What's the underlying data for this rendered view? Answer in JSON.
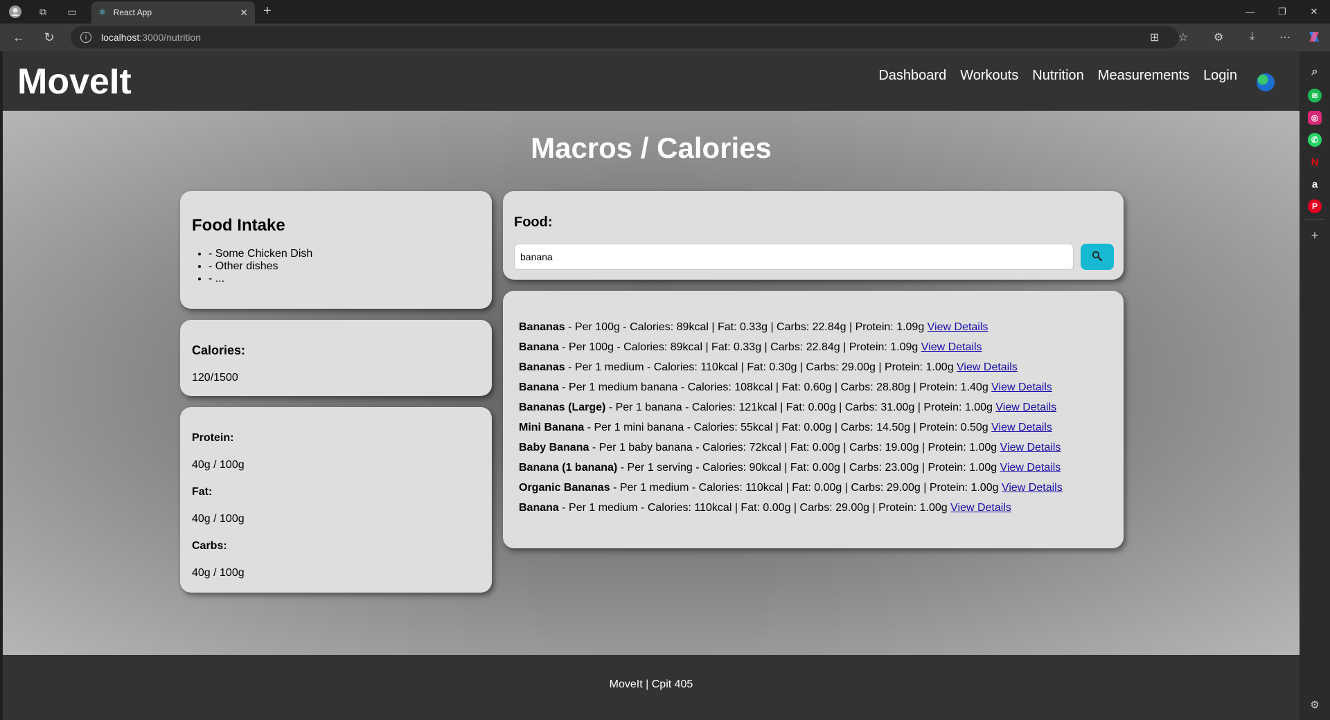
{
  "browser": {
    "tab_title": "React App",
    "url_host": "localhost",
    "url_path": ":3000/nutrition"
  },
  "app": {
    "brand": "MoveIt",
    "nav": [
      "Dashboard",
      "Workouts",
      "Nutrition",
      "Measurements",
      "Login"
    ]
  },
  "main": {
    "title": "Macros / Calories"
  },
  "food_intake": {
    "title": "Food Intake",
    "items": [
      "- Some Chicken Dish",
      "- Other dishes",
      "- ..."
    ]
  },
  "calories": {
    "label": "Calories:",
    "value": "120/1500"
  },
  "macros": [
    {
      "label": "Protein:",
      "value": "40g / 100g"
    },
    {
      "label": "Fat:",
      "value": "40g / 100g"
    },
    {
      "label": "Carbs:",
      "value": "40g / 100g"
    }
  ],
  "search": {
    "label": "Food:",
    "value": "banana"
  },
  "results": {
    "link_label": "View Details",
    "items": [
      {
        "name": "Bananas",
        "details": " - Per 100g - Calories: 89kcal | Fat: 0.33g | Carbs: 22.84g | Protein: 1.09g "
      },
      {
        "name": "Banana",
        "details": " - Per 100g - Calories: 89kcal | Fat: 0.33g | Carbs: 22.84g | Protein: 1.09g "
      },
      {
        "name": "Bananas",
        "details": " - Per 1 medium - Calories: 110kcal | Fat: 0.30g | Carbs: 29.00g | Protein: 1.00g "
      },
      {
        "name": "Banana",
        "details": " - Per 1 medium banana - Calories: 108kcal | Fat: 0.60g | Carbs: 28.80g | Protein: 1.40g "
      },
      {
        "name": "Bananas (Large)",
        "details": " - Per 1 banana - Calories: 121kcal | Fat: 0.00g | Carbs: 31.00g | Protein: 1.00g "
      },
      {
        "name": "Mini Banana",
        "details": " - Per 1 mini banana - Calories: 55kcal | Fat: 0.00g | Carbs: 14.50g | Protein: 0.50g "
      },
      {
        "name": "Baby Banana",
        "details": " - Per 1 baby banana - Calories: 72kcal | Fat: 0.00g | Carbs: 19.00g | Protein: 1.00g "
      },
      {
        "name": "Banana (1 banana)",
        "details": " - Per 1 serving - Calories: 90kcal | Fat: 0.00g | Carbs: 23.00g | Protein: 1.00g "
      },
      {
        "name": "Organic Bananas",
        "details": " - Per 1 medium - Calories: 110kcal | Fat: 0.00g | Carbs: 29.00g | Protein: 1.00g "
      },
      {
        "name": "Banana",
        "details": " - Per 1 medium - Calories: 110kcal | Fat: 0.00g | Carbs: 29.00g | Protein: 1.00g "
      }
    ]
  },
  "footer": {
    "text": "MoveIt | Cpit 405"
  },
  "colors": {
    "header_bg": "#333333",
    "card_bg": "#dedede",
    "search_button": "#17b8d2",
    "link": "#1a0dab"
  },
  "icons": {
    "search_button": "magnifier-icon",
    "globe": "globe-icon"
  }
}
